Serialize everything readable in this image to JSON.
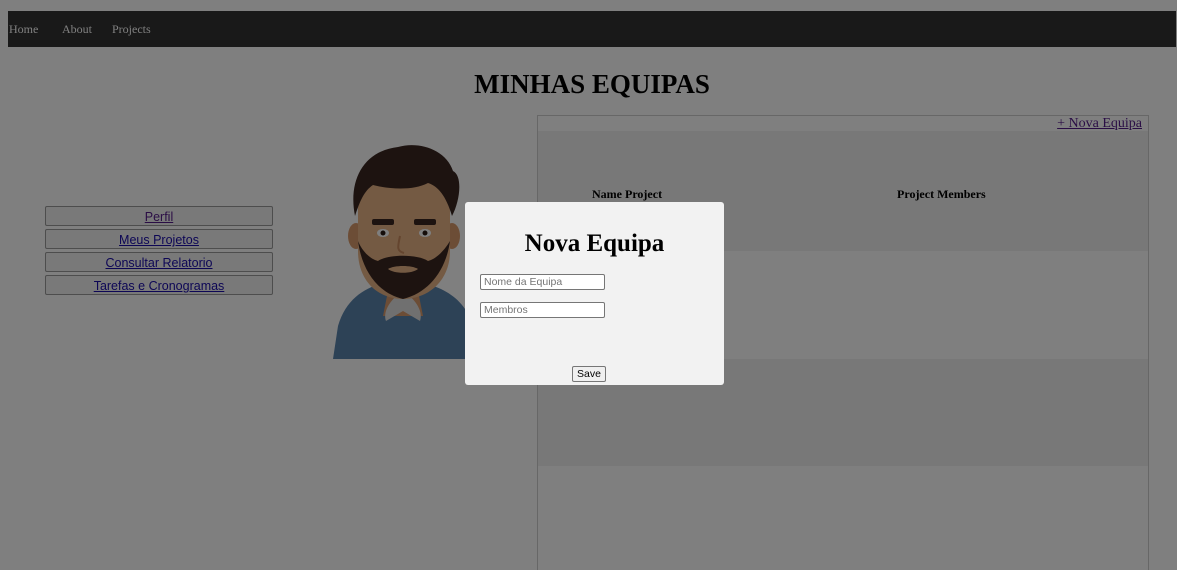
{
  "nav": {
    "items": [
      "Home",
      "About",
      "Projects"
    ]
  },
  "page_title": "MINHAS EQUIPAS",
  "side_menu": [
    "Perfil",
    "Meus Projetos",
    "Consultar Relatorio",
    "Tarefas e Cronogramas"
  ],
  "teams": {
    "new_team_link": "+ Nova Equipa",
    "col_name": "Name Project",
    "col_members": "Project Members"
  },
  "modal": {
    "title": "Nova Equipa",
    "name_placeholder": "Nome da Equipa",
    "members_placeholder": "Membros",
    "save_label": "Save"
  },
  "colors": {
    "navbar": "#333333",
    "overlay": "rgba(0,0,0,0.5)",
    "modal": "#f2f2f2"
  },
  "icons": {
    "avatar": "bearded-man-avatar"
  }
}
